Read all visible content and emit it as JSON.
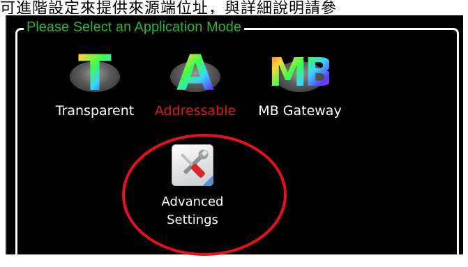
{
  "caption_text": "可進階設定來提供來源端位址，與詳細說明請參",
  "group": {
    "title": "Please Select an Application Mode"
  },
  "modes": [
    {
      "label": "Transparent",
      "icon": "T",
      "icon_name": "transparent-mode-icon",
      "selected": false
    },
    {
      "label": "Addressable",
      "icon": "A",
      "icon_name": "addressable-mode-icon",
      "selected": true
    },
    {
      "label": "MB Gateway",
      "icon": "MB",
      "icon_name": "mb-gateway-mode-icon",
      "selected": false
    }
  ],
  "advanced": {
    "line1": "Advanced",
    "line2": "Settings",
    "icon_name": "tools-icon"
  },
  "colors": {
    "legend": "#2db52d",
    "selected_label": "#e01818",
    "annotation": "#e8101a",
    "background": "#000000"
  }
}
